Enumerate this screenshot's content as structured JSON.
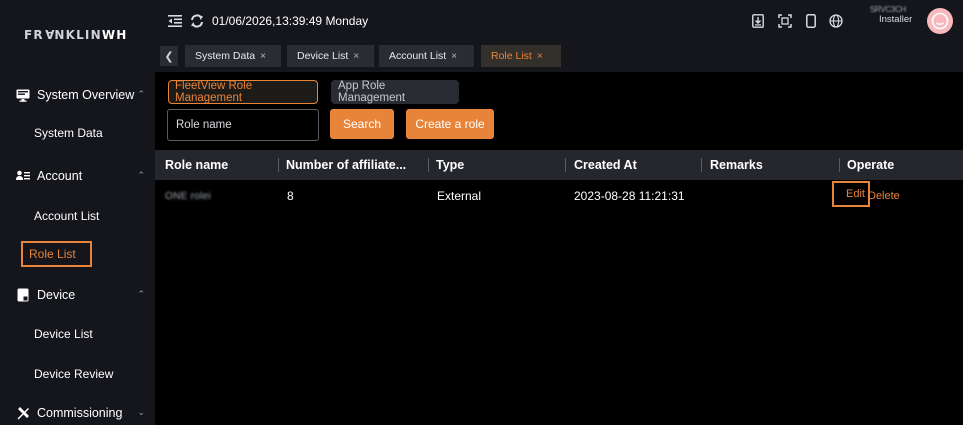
{
  "brand": {
    "logo_part1": "FR",
    "logo_a": "A",
    "logo_part2": "NKLIN",
    "logo_bold": "WH"
  },
  "colors": {
    "accent": "#e8843a",
    "sidebar_bg": "#15161b",
    "header_row_bg": "#25272d",
    "main_bg": "#000000"
  },
  "topbar": {
    "datetime": "01/06/2026,13:39:49 Monday",
    "user_name": "SRVC3CH",
    "user_role": "Installer",
    "icons": [
      "menu-fold-icon",
      "refresh-icon",
      "download-icon",
      "fullscreen-icon",
      "mobile-icon",
      "globe-icon",
      "avatar-icon"
    ]
  },
  "sidebar": {
    "groups": [
      {
        "label": "System Overview",
        "icon": "monitor-icon",
        "expanded": true
      },
      {
        "label": "Account",
        "icon": "account-list-icon",
        "expanded": true
      },
      {
        "label": "Device",
        "icon": "device-icon",
        "expanded": true
      },
      {
        "label": "Commissioning",
        "icon": "tools-icon",
        "expanded": false
      }
    ],
    "items": [
      {
        "label": "System Data"
      },
      {
        "label": "Account List"
      },
      {
        "label": "Role List",
        "active": true
      },
      {
        "label": "Device List"
      },
      {
        "label": "Device Review"
      }
    ]
  },
  "tabs": [
    {
      "label": "System Data",
      "close": "×"
    },
    {
      "label": "Device List",
      "close": "×"
    },
    {
      "label": "Account List",
      "close": "×"
    },
    {
      "label": "Role List",
      "close": "×",
      "active": true
    }
  ],
  "main": {
    "role_tabs": [
      {
        "label": "FleetView Role Management",
        "active": true
      },
      {
        "label": "App Role Management",
        "active": false
      }
    ],
    "search": {
      "placeholder": "Role name",
      "value": ""
    },
    "search_button": "Search",
    "create_button": "Create a role"
  },
  "table": {
    "columns": [
      "Role name",
      "Number of affiliate...",
      "Type",
      "Created At",
      "Remarks",
      "Operate"
    ],
    "rows": [
      {
        "role_name": "ONE rolei",
        "count": "8",
        "type": "External",
        "created_at": "2023-08-28 11:21:31",
        "remarks": "",
        "edit": "Edit",
        "delete": "Delete"
      }
    ]
  }
}
